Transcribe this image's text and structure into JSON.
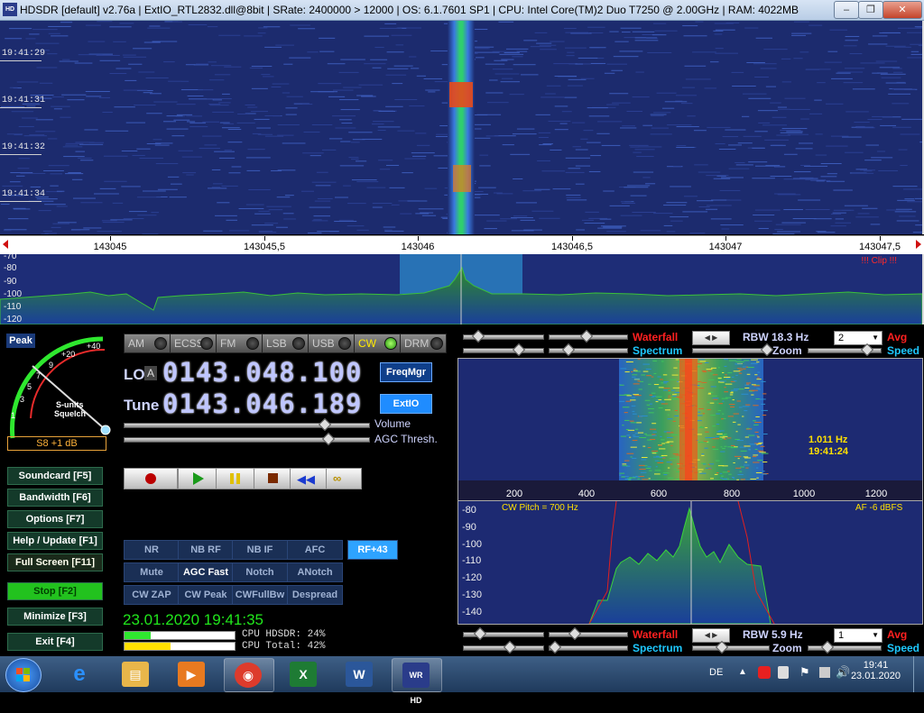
{
  "window": {
    "title": "HDSDR  [default]  v2.76a  |  ExtIO_RTL2832.dll@8bit  |  SRate: 2400000 > 12000  |  OS: 6.1.7601 SP1  |  CPU: Intel Core(TM)2 Duo      T7250  @ 2.00GHz  |  RAM: 4022MB",
    "app_icon": "HD",
    "minimize": "–",
    "maximize": "❐",
    "close": "✕"
  },
  "waterfall": {
    "times": [
      "19:41:29",
      "19:41:31",
      "19:41:32",
      "19:41:34"
    ]
  },
  "freq_scale": {
    "labels": [
      "143045",
      "143045,5",
      "143046",
      "143046,5",
      "143047",
      "143047,5"
    ]
  },
  "spectrum": {
    "db_labels": [
      "-70",
      "-80",
      "-90",
      "-100",
      "-110",
      "-120"
    ],
    "clip": "!!! Clip !!!"
  },
  "smeter": {
    "peak": "Peak",
    "scale": [
      "1",
      "3",
      "5",
      "7",
      "9",
      "+20",
      "+40"
    ],
    "caption1": "S-units",
    "caption2": "Squelch",
    "reading": "S8 +1 dB"
  },
  "modes": [
    {
      "label": "AM",
      "active": false
    },
    {
      "label": "ECSS",
      "active": false
    },
    {
      "label": "FM",
      "active": false
    },
    {
      "label": "LSB",
      "active": false
    },
    {
      "label": "USB",
      "active": false
    },
    {
      "label": "CW",
      "active": true
    },
    {
      "label": "DRM",
      "active": false
    }
  ],
  "lo": {
    "label": "LO",
    "tag": "A",
    "freq": "0143.048.100"
  },
  "tune": {
    "label": "Tune",
    "freq": "0143.046.189"
  },
  "buttons": {
    "freqmgr": "FreqMgr",
    "extio": "ExtIO"
  },
  "sliders": {
    "volume": "Volume",
    "agc": "AGC Thresh."
  },
  "side_buttons": [
    {
      "label": "Soundcard  [F5]",
      "state": "normal"
    },
    {
      "label": "Bandwidth  [F6]",
      "state": "normal"
    },
    {
      "label": "Options   [F7]",
      "state": "normal"
    },
    {
      "label": "Help / Update  [F1]",
      "state": "normal"
    },
    {
      "label": "Full Screen  [F11]",
      "state": "fs"
    },
    {
      "label": "Stop        [F2]",
      "state": "active"
    },
    {
      "label": "Minimize  [F3]",
      "state": "normal"
    },
    {
      "label": "Exit      [F4]",
      "state": "normal"
    }
  ],
  "dsp": [
    [
      "NR",
      "NB RF",
      "NB IF",
      "AFC",
      "RF+43"
    ],
    [
      "Mute",
      "AGC Fast",
      "Notch",
      "ANotch"
    ],
    [
      "CW ZAP",
      "CW Peak",
      "CWFullBw",
      "Despread"
    ]
  ],
  "status": {
    "datetime": "23.01.2020 19:41:35",
    "cpu_hdsdr": "CPU HDSDR: 24%",
    "cpu_total": "CPU Total: 42%",
    "cpu_hdsdr_level": 0.24,
    "cpu_total_level": 0.42
  },
  "right_top": {
    "waterfall": "Waterfall",
    "spectrum": "Spectrum",
    "rbw": "RBW 18.3 Hz",
    "avg_value": "2",
    "avg": "Avg",
    "zoom": "Zoom",
    "speed": "Speed"
  },
  "audio_wf": {
    "readout_freq": "1.011 Hz",
    "readout_time": "19:41:24",
    "axis": [
      "200",
      "400",
      "600",
      "800",
      "1000",
      "1200"
    ]
  },
  "audio_spec": {
    "cw_pitch": "CW Pitch = 700 Hz",
    "af": "AF  -6 dBFS",
    "db_labels": [
      "-80",
      "-90",
      "-100",
      "-110",
      "-120",
      "-130",
      "-140"
    ]
  },
  "right_bottom": {
    "waterfall": "Waterfall",
    "spectrum": "Spectrum",
    "rbw": "RBW  5.9 Hz",
    "avg_value": "1",
    "avg": "Avg",
    "zoom": "Zoom",
    "speed": "Speed"
  },
  "taskbar": {
    "lang": "DE",
    "time": "19:41",
    "date": "23.01.2020",
    "apps": [
      {
        "name": "start-button"
      },
      {
        "name": "ie-icon",
        "glyph": "e",
        "color": "#1e90ff"
      },
      {
        "name": "explorer-icon",
        "glyph": "▤",
        "color": "#e8b64a"
      },
      {
        "name": "media-player-icon",
        "glyph": "▶",
        "color": "#e87a20"
      },
      {
        "name": "chrome-icon",
        "glyph": "◉",
        "color": "#dd3b2c"
      },
      {
        "name": "excel-icon",
        "glyph": "X",
        "color": "#1e7b34"
      },
      {
        "name": "word-icon",
        "glyph": "W",
        "color": "#2b579a"
      },
      {
        "name": "hdsdr-icon",
        "glyph": "WR HD",
        "color": "#2a3c8a"
      }
    ]
  }
}
